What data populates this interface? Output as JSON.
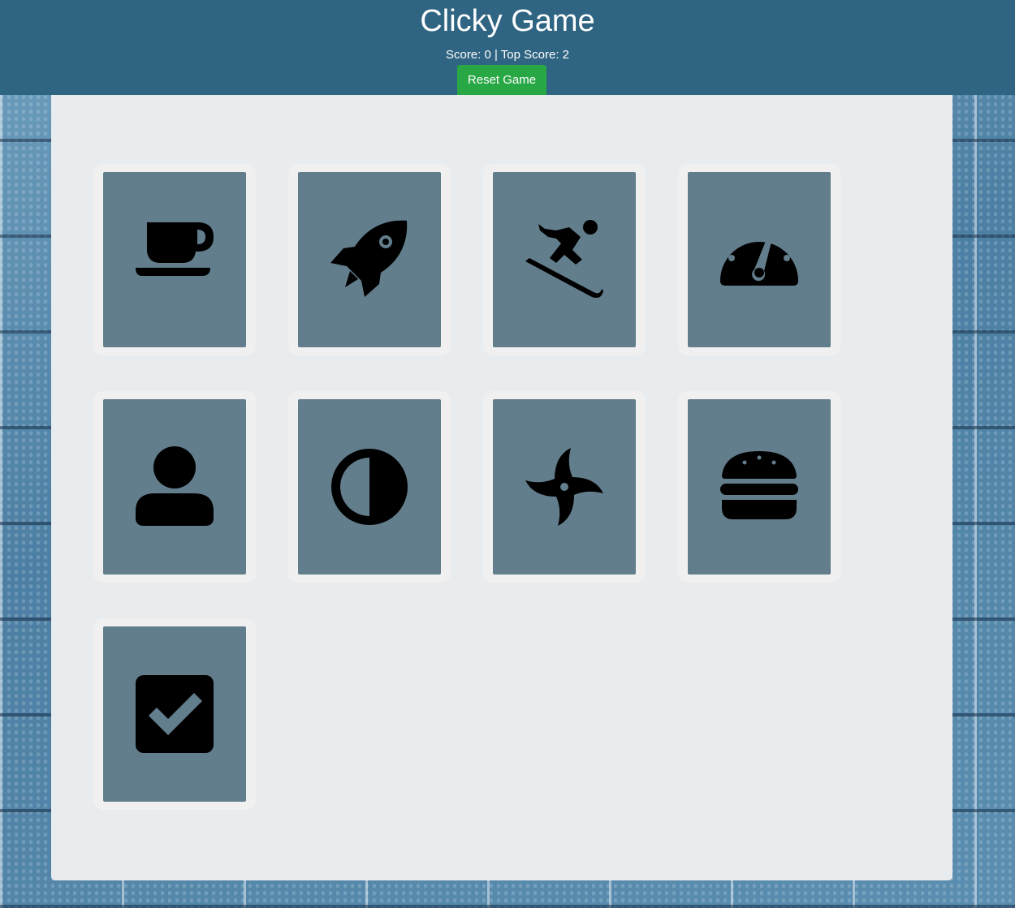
{
  "header": {
    "title": "Clicky Game",
    "score_line": "Score: 0 | Top Score: 2",
    "reset_label": "Reset Game"
  },
  "colors": {
    "header_bg": "#2f6482",
    "reset_button": "#28a745",
    "board_bg": "#e9ecef",
    "card_face": "#627d8c",
    "icon": "#000000"
  },
  "cards": [
    {
      "icon": "coffee-cup-icon"
    },
    {
      "icon": "rocket-icon"
    },
    {
      "icon": "skier-icon"
    },
    {
      "icon": "speedometer-icon"
    },
    {
      "icon": "user-icon"
    },
    {
      "icon": "adjust-contrast-icon"
    },
    {
      "icon": "pinwheel-fan-icon"
    },
    {
      "icon": "hamburger-icon"
    },
    {
      "icon": "checkbox-checked-icon"
    }
  ]
}
